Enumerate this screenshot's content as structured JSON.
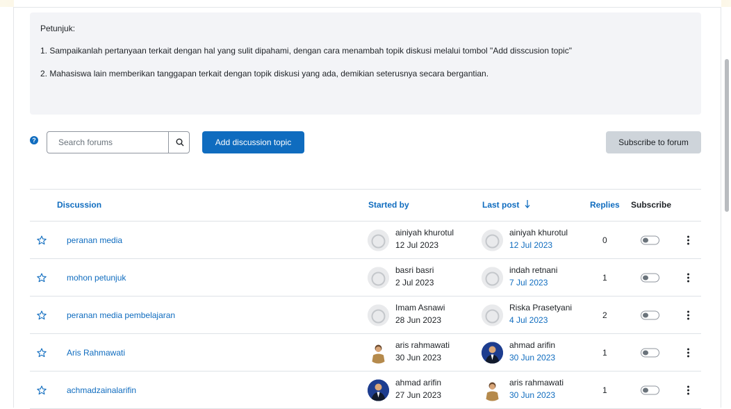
{
  "instructions": {
    "heading": "Petunjuk:",
    "line1": "1. Sampaikanlah pertanyaan terkait dengan hal yang sulit dipahami, dengan cara menambah topik diskusi melalui tombol \"Add disscusion topic\"",
    "line2": "2. Mahasiswa lain memberikan tanggapan terkait dengan topik diskusi yang ada, demikian seterusnya secara bergantian."
  },
  "toolbar": {
    "search_placeholder": "Search forums",
    "add_topic_label": "Add discussion topic",
    "subscribe_label": "Subscribe to forum"
  },
  "table": {
    "headers": {
      "discussion": "Discussion",
      "started_by": "Started by",
      "last_post": "Last post",
      "replies": "Replies",
      "subscribe": "Subscribe"
    },
    "rows": [
      {
        "topic": "peranan media",
        "starter": "ainiyah khurotul",
        "start_date": "12 Jul 2023",
        "last_by": "ainiyah khurotul",
        "last_date": "12 Jul 2023",
        "replies": "0",
        "subscribed": false
      },
      {
        "topic": "mohon petunjuk",
        "starter": "basri basri",
        "start_date": "2 Jul 2023",
        "last_by": "indah retnani",
        "last_date": "7 Jul 2023",
        "replies": "1",
        "subscribed": false
      },
      {
        "topic": "peranan media pembelajaran",
        "starter": "Imam Asnawi",
        "start_date": "28 Jun 2023",
        "last_by": "Riska Prasetyani",
        "last_date": "4 Jul 2023",
        "replies": "2",
        "subscribed": false
      },
      {
        "topic": "Aris Rahmawati",
        "starter": "aris rahmawati",
        "start_date": "30 Jun 2023",
        "last_by": "ahmad arifin",
        "last_date": "30 Jun 2023",
        "replies": "1",
        "subscribed": false
      },
      {
        "topic": "achmadzainalarifin",
        "starter": "ahmad arifin",
        "start_date": "27 Jun 2023",
        "last_by": "aris rahmawati",
        "last_date": "30 Jun 2023",
        "replies": "1",
        "subscribed": false
      }
    ]
  },
  "colors": {
    "primary": "#0f6cbf",
    "secondary_button": "#ced4da",
    "intro_background": "#f3f4f7"
  },
  "icons": [
    "help-icon",
    "search-icon",
    "star-icon",
    "sort-down-icon",
    "kebab-menu-icon",
    "avatar-placeholder-icon"
  ]
}
